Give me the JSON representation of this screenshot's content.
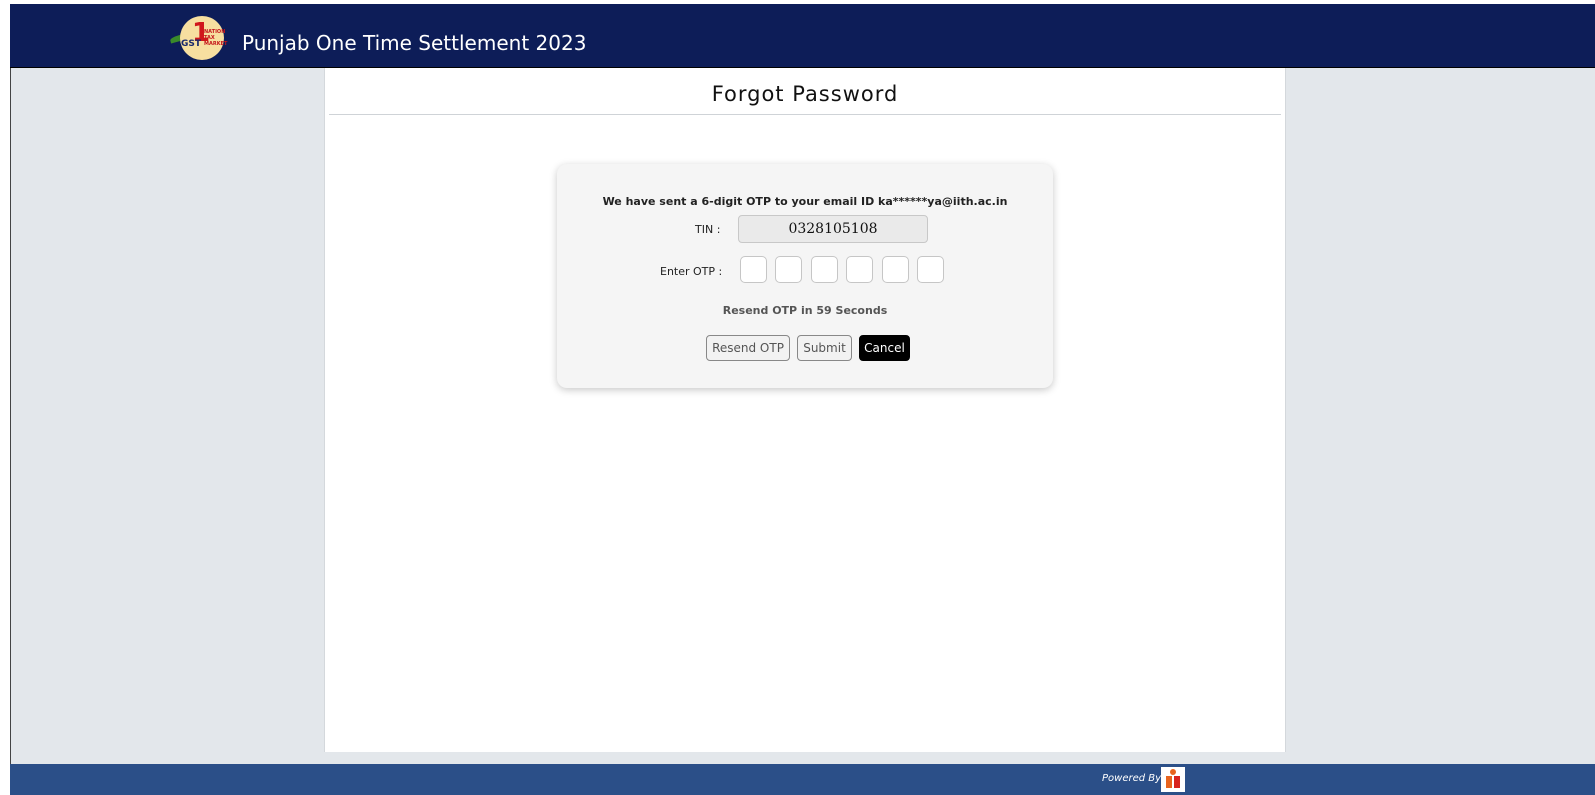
{
  "header": {
    "logo_icon": "one-nation-one-tax-gst-logo",
    "logo_text": {
      "main": "GST",
      "small": "NATION TAX MARKET"
    },
    "title": "Punjab One Time Settlement 2023"
  },
  "page": {
    "title": "Forgot Password"
  },
  "form": {
    "otp_message": "We have sent a 6-digit OTP to your email ID ka******ya@iith.ac.in",
    "tin_label": "TIN :",
    "tin_value": "0328105108",
    "otp_label": "Enter OTP :",
    "otp_digits": [
      "",
      "",
      "",
      "",
      "",
      ""
    ],
    "resend_message": "Resend OTP in 59 Seconds",
    "buttons": {
      "resend": "Resend OTP",
      "submit": "Submit",
      "cancel": "Cancel"
    }
  },
  "footer": {
    "powered_by": "Powered By",
    "logo_icon": "vendor-logo"
  },
  "colors": {
    "header_bg": "#0d1d58",
    "footer_bg": "#2b4f88",
    "page_bg": "#e3e7eb",
    "cancel_bg": "#000000"
  }
}
